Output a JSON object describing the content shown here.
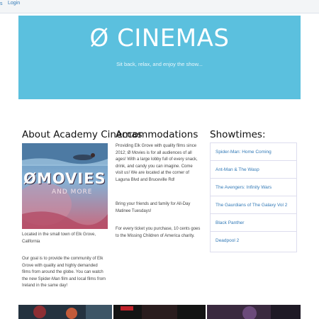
{
  "nav": {
    "left_fragment": "s",
    "login": "Login"
  },
  "hero": {
    "title": "Ø CINEMAS",
    "tagline": "Sit back, relax, and enjoy the show..."
  },
  "about": {
    "heading": "About Academy Cinemas",
    "poster_logo_main": "ØMOVIES",
    "poster_logo_sub": "AND MORE",
    "location": "Located in the small town of Elk Grove, California",
    "goal": "Our goal is to provide the community of Elk Grove with quality and highly demanded films from around the globe. You can watch the new Spider-Man film and local films from Ireland in the same day!"
  },
  "accommodations": {
    "heading": "Accommodations",
    "p1": "Providing Elk Grove with quality films since 2012; Ø Movies is for all audiences of all ages! With a large lobby full of every snack, drink, and candy you can imagine. Come visit us! We are located at the corner of Laguna Blvd and Bruceville Rd!",
    "p2": "Bring your friends and family for All-Day Matinee Tuesdays!",
    "p3": "For every ticket you purchase, 10 cents goes to the Missing Children of America charity."
  },
  "showtimes": {
    "heading": "Showtimes:",
    "items": [
      "Spider-Man: Home Coming",
      "Ant-Man & The Wasp",
      "The Avengers: Infinity Wars",
      "The Gaurdians of The Galaxy Vol 2",
      "Black Panther",
      "Deadpool 2"
    ]
  },
  "colors": {
    "hero_bg": "#5bc0de",
    "link": "#337ab7"
  }
}
